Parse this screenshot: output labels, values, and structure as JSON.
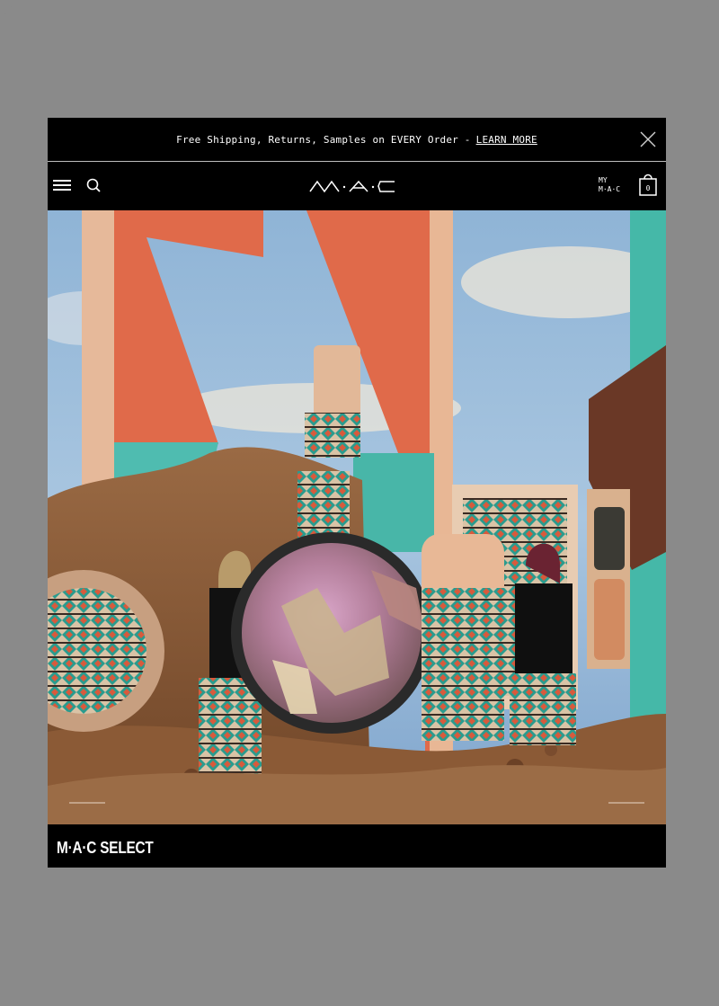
{
  "promo": {
    "text": "Free Shipping, Returns, Samples on EVERY Order -",
    "link_label": "LEARN MORE"
  },
  "header": {
    "logo_text": "M·A·C",
    "account_line1": "MY",
    "account_line2": "M·A·C",
    "bag_count": "0"
  },
  "hero": {
    "caption": "M·A·C SELECT"
  },
  "icons": {
    "menu": "hamburger-icon",
    "search": "search-icon",
    "close": "close-icon",
    "bag": "shopping-bag-icon",
    "prev": "arrow-left-icon",
    "next": "arrow-right-icon"
  },
  "colors": {
    "background": "#000000",
    "text": "#ffffff",
    "frame": "#8a8a8a"
  }
}
